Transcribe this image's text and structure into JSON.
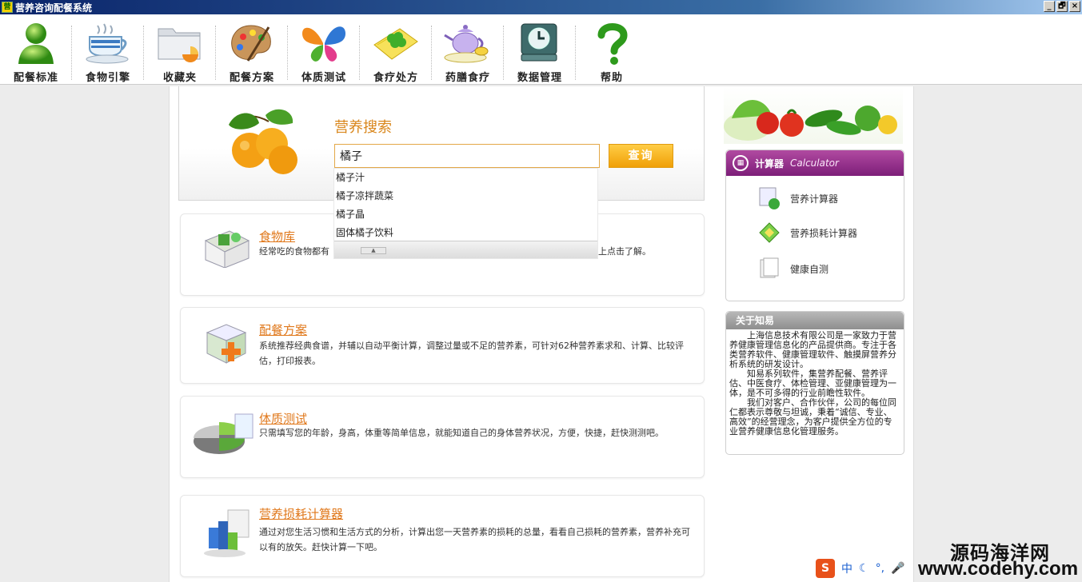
{
  "window": {
    "title": "营养咨询配餐系统",
    "controls": [
      "_",
      "🗗",
      "×"
    ]
  },
  "toolbar": [
    {
      "label": "配餐标准",
      "icon": "person-icon"
    },
    {
      "label": "食物引擎",
      "icon": "coffee-cup-icon"
    },
    {
      "label": "收藏夹",
      "icon": "folder-icon"
    },
    {
      "label": "配餐方案",
      "icon": "palette-icon"
    },
    {
      "label": "体质测试",
      "icon": "butterfly-icon"
    },
    {
      "label": "食疗处方",
      "icon": "notebook-clover-icon"
    },
    {
      "label": "药膳食疗",
      "icon": "teapot-icon"
    },
    {
      "label": "数据管理",
      "icon": "database-clock-icon"
    },
    {
      "label": "帮助",
      "icon": "help-question-icon"
    }
  ],
  "search": {
    "title": "营养搜索",
    "query": "橘子",
    "button": "查询",
    "suggestions": [
      "橘子汁",
      "橘子凉拌蔬菜",
      "橘子晶",
      "固体橘子饮料"
    ]
  },
  "cards": [
    {
      "title": "食物库",
      "desc": "经常吃的食物都有",
      "desc_tail": "码上点击了解。",
      "icon": "food-library-icon"
    },
    {
      "title": "配餐方案",
      "desc": "系统推荐经典食谱，并辅以自动平衡计算，调整过量或不足的营养素，可针对62种营养素求和、计算、比较评估，打印报表。",
      "icon": "meal-plan-icon"
    },
    {
      "title": "体质测试",
      "desc": "只需填写您的年龄，身高，体重等简单信息，就能知道自己的身体营养状况，方便，快捷，赶快测测吧。",
      "icon": "pie-chart-icon"
    },
    {
      "title": "营养损耗计算器",
      "desc": "通过对您生活习惯和生活方式的分析，计算出您一天营养素的损耗的总量，看看自己损耗的营养素，营养补充可以有的放矢。赶快计算一下吧。",
      "icon": "bar-chart-icon"
    }
  ],
  "calculator": {
    "title": "计算器",
    "subtitle": "Calculator",
    "items": [
      {
        "label": "营养计算器",
        "icon": "nutrition-calc-icon"
      },
      {
        "label": "营养损耗计算器",
        "icon": "loss-calc-icon"
      },
      {
        "label": "健康自测",
        "icon": "self-test-icon"
      }
    ]
  },
  "about": {
    "title": "关于知易",
    "paragraphs": [
      "上海信息技术有限公司是一家致力于营养健康管理信息化的产品提供商。专注于各类营养软件、健康管理软件、触摸屏营养分析系统的研发设计。",
      "知易系列软件，集营养配餐、营养评估、中医食疗、体检管理、亚健康管理为一体，是不可多得的行业前瞻性软件。",
      "我们对客户、合作伙伴，公司的每位同仁都表示尊敬与坦诚，秉着“诚信、专业、高效”的经营理念，为客户提供全方位的专业营养健康信息化管理服务。"
    ]
  },
  "overlay": {
    "tray_text": "中",
    "watermark_cn": "源码海洋网",
    "watermark_url": "www.codehy.com"
  },
  "colors": {
    "accent_orange": "#e0781b",
    "calc_purple": "#9b3490",
    "titlebar_blue": "#0a246a"
  }
}
